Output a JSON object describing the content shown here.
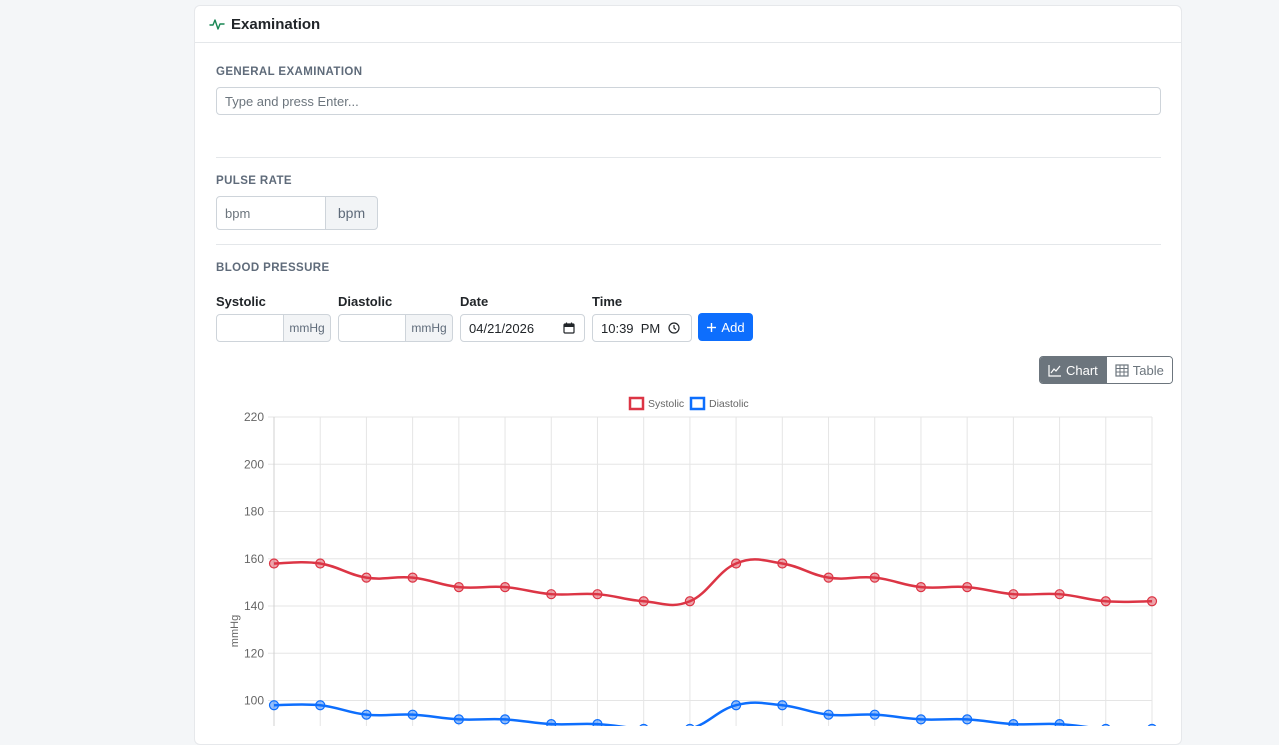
{
  "card": {
    "title": "Examination",
    "icon": "activity-icon"
  },
  "general_examination": {
    "label": "GENERAL EXAMINATION",
    "placeholder": "Type and press Enter..."
  },
  "pulse_rate": {
    "label": "PULSE RATE",
    "placeholder": "bpm",
    "unit": "bpm"
  },
  "blood_pressure": {
    "label": "BLOOD PRESSURE",
    "systolic_label": "Systolic",
    "systolic_unit": "mmHg",
    "diastolic_label": "Diastolic",
    "diastolic_unit": "mmHg",
    "date_label": "Date",
    "date_value": "04/21/2026",
    "time_label": "Time",
    "time_value": "10:39  PM",
    "add_label": "Add"
  },
  "view_toggle": {
    "chart_label": "Chart",
    "table_label": "Table",
    "active": "chart"
  },
  "colors": {
    "systolic": "#dc3545",
    "diastolic": "#0d6efd",
    "primary": "#0d6efd",
    "secondary": "#6c757d"
  },
  "chart_data": {
    "type": "line",
    "ylabel": "mmHg",
    "ylim": [
      60,
      220
    ],
    "yticks": [
      100,
      120,
      140,
      160,
      180,
      200,
      220
    ],
    "grid": true,
    "legend": "top-center",
    "x": [
      1,
      2,
      3,
      4,
      5,
      6,
      7,
      8,
      9,
      10,
      11,
      12,
      13,
      14,
      15,
      16,
      17,
      18,
      19,
      20
    ],
    "series": [
      {
        "name": "Systolic",
        "color": "#dc3545",
        "values": [
          158,
          158,
          152,
          152,
          148,
          148,
          145,
          145,
          142,
          142,
          158,
          158,
          152,
          152,
          148,
          148,
          145,
          145,
          142,
          142
        ]
      },
      {
        "name": "Diastolic",
        "color": "#0d6efd",
        "values": [
          98,
          98,
          94,
          94,
          92,
          92,
          90,
          90,
          88,
          88,
          98,
          98,
          94,
          94,
          92,
          92,
          90,
          90,
          88,
          88
        ]
      }
    ]
  }
}
